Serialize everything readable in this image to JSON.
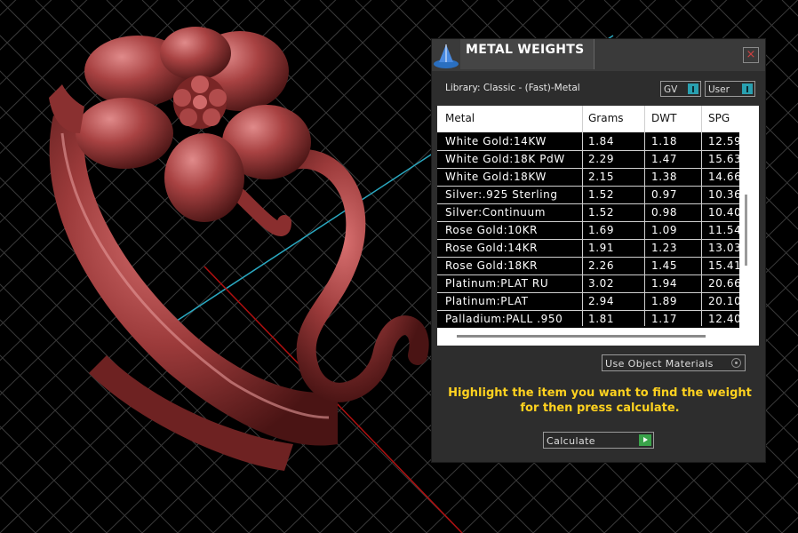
{
  "panel": {
    "title": "METAL WEIGHTS",
    "close_icon": "close-icon",
    "library_label": "Library: Classic - (Fast)-Metal",
    "gv_label": "GV",
    "user_label": "User",
    "columns": [
      "Metal",
      "Grams",
      "DWT",
      "SPG"
    ],
    "rows": [
      {
        "metal": "White Gold:14KW",
        "grams": "1.84",
        "dwt": "1.18",
        "spg": "12.59"
      },
      {
        "metal": "White Gold:18K PdW",
        "grams": "2.29",
        "dwt": "1.47",
        "spg": "15.63"
      },
      {
        "metal": "White Gold:18KW",
        "grams": "2.15",
        "dwt": "1.38",
        "spg": "14.66"
      },
      {
        "metal": "Silver:.925 Sterling",
        "grams": "1.52",
        "dwt": "0.97",
        "spg": "10.36"
      },
      {
        "metal": "Silver:Continuum",
        "grams": "1.52",
        "dwt": "0.98",
        "spg": "10.40"
      },
      {
        "metal": "Rose Gold:10KR",
        "grams": "1.69",
        "dwt": "1.09",
        "spg": "11.54"
      },
      {
        "metal": "Rose Gold:14KR",
        "grams": "1.91",
        "dwt": "1.23",
        "spg": "13.03"
      },
      {
        "metal": "Rose Gold:18KR",
        "grams": "2.26",
        "dwt": "1.45",
        "spg": "15.41"
      },
      {
        "metal": "Platinum:PLAT RU",
        "grams": "3.02",
        "dwt": "1.94",
        "spg": "20.66"
      },
      {
        "metal": "Platinum:PLAT",
        "grams": "2.94",
        "dwt": "1.89",
        "spg": "20.10"
      },
      {
        "metal": "Palladium:PALL .950",
        "grams": "1.81",
        "dwt": "1.17",
        "spg": "12.40"
      }
    ],
    "use_object_materials": "Use Object Materials",
    "hint": "Highlight the item you want to find the weight for then press calculate.",
    "calculate_label": "Calculate"
  },
  "colors": {
    "accent_teal": "#29a0b0",
    "hint_yellow": "#ffd21f",
    "ring_red": "#9b3a3a",
    "go_green": "#3aa34a"
  }
}
